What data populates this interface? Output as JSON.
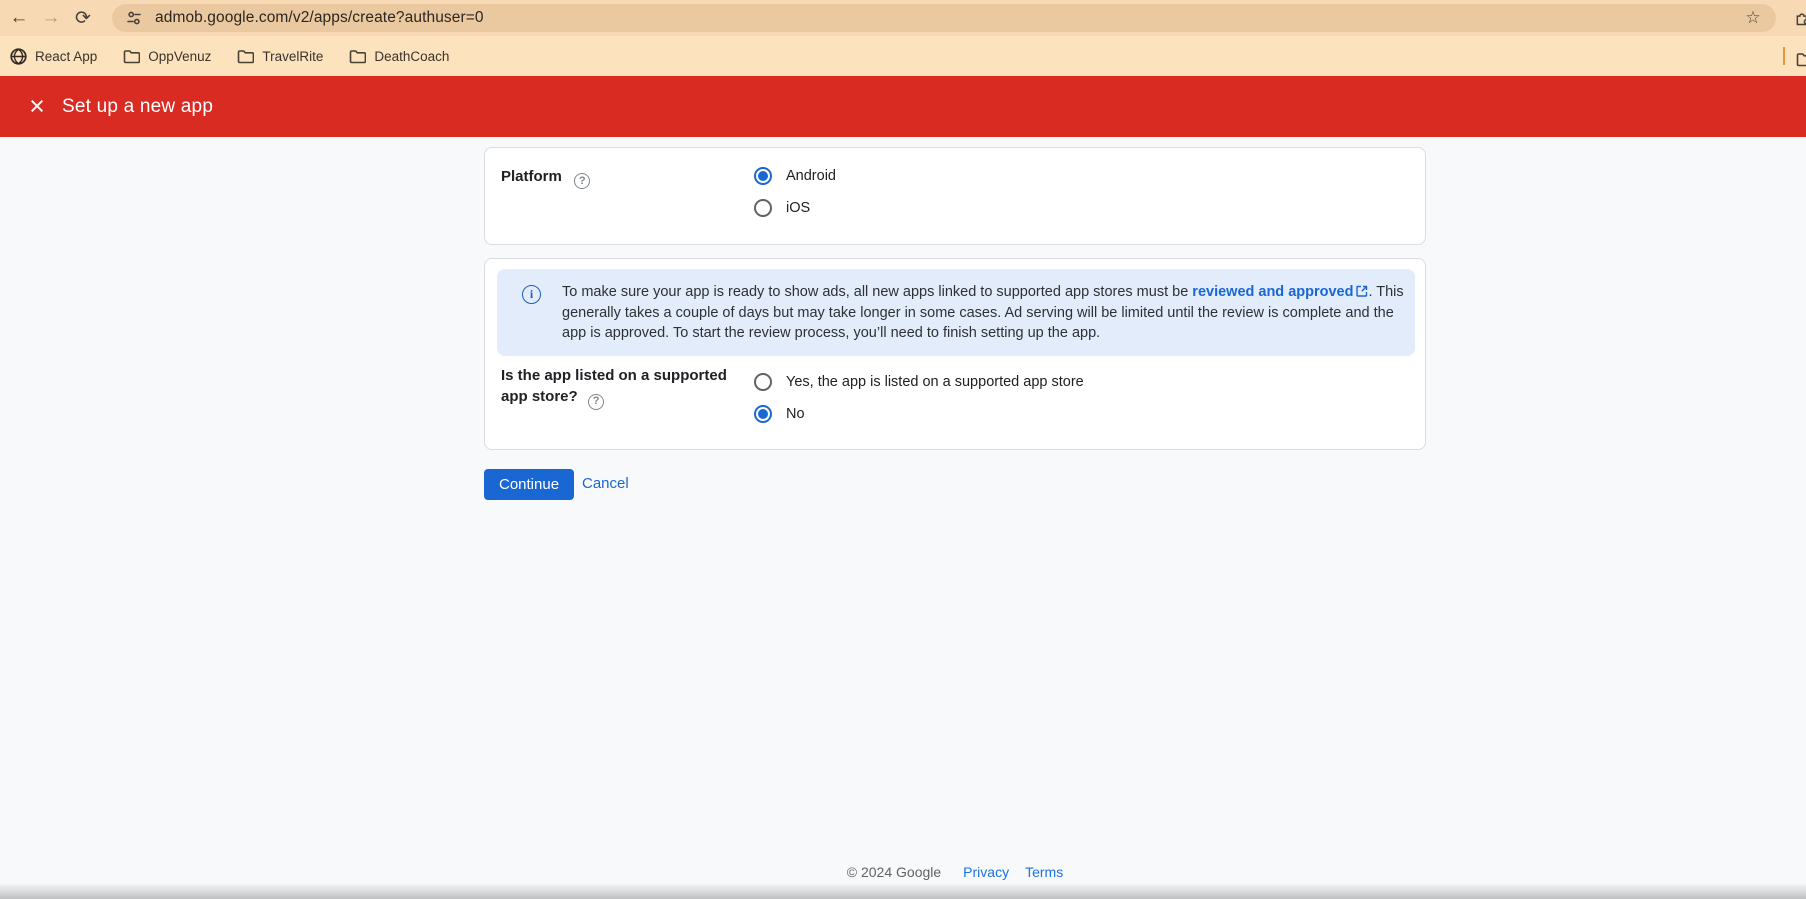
{
  "browser": {
    "url": "admob.google.com/v2/apps/create?authuser=0",
    "back_label": "←",
    "forward_label": "→",
    "reload_label": "⟳",
    "star_label": "☆",
    "bookmarks": {
      "items": [
        {
          "label": "React App",
          "icon": "globe-icon"
        },
        {
          "label": "OppVenuz",
          "icon": "folder-icon"
        },
        {
          "label": "TravelRite",
          "icon": "folder-icon"
        },
        {
          "label": "DeathCoach",
          "icon": "folder-icon"
        }
      ]
    }
  },
  "header": {
    "close_label": "×",
    "title": "Set up a new app"
  },
  "form": {
    "platform": {
      "label": "Platform",
      "help_glyph": "?",
      "options": [
        {
          "label": "Android",
          "selected": true
        },
        {
          "label": "iOS",
          "selected": false
        }
      ]
    },
    "notice": {
      "info_glyph": "i",
      "text_before_link": "To make sure your app is ready to show ads, all new apps linked to supported app stores must be ",
      "link_text": "reviewed and approved",
      "text_after_link": ". This generally takes a couple of days but may take longer in some cases. Ad serving will be limited until the review is complete and the app is approved. To start the review process, you’ll need to finish setting up the app."
    },
    "store_question": {
      "label_line1": "Is the app listed on a supported",
      "label_line2": "app store?",
      "help_glyph": "?",
      "options": [
        {
          "label": "Yes, the app is listed on a supported app store",
          "selected": false
        },
        {
          "label": "No",
          "selected": true
        }
      ]
    },
    "continue_label": "Continue",
    "cancel_label": "Cancel"
  },
  "footer": {
    "copyright": "© 2024 Google",
    "privacy": "Privacy",
    "terms": "Terms"
  },
  "colors": {
    "header_red": "#da2b23",
    "accent_blue": "#1967d2",
    "link_blue": "#1a73e8",
    "notice_bg": "#e3ecfb",
    "toolbar_peach": "#f7d9b3",
    "bookmarks_peach": "#fce3bd",
    "urlbar_peach": "#eac8a0"
  }
}
